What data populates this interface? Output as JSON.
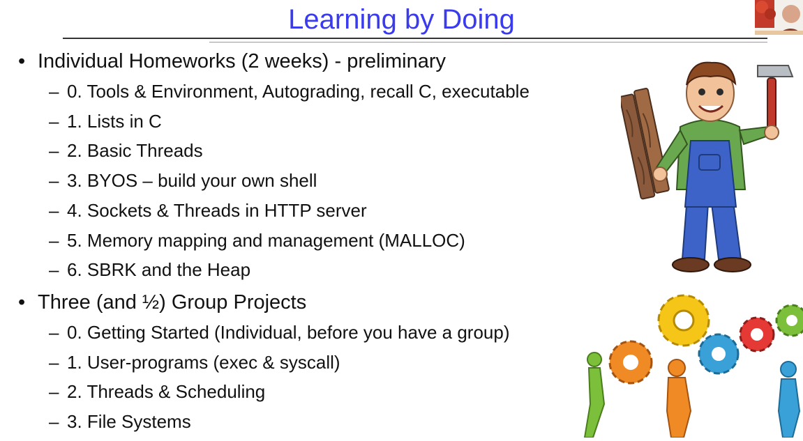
{
  "slide": {
    "title": "Learning by Doing",
    "sections": [
      {
        "heading": "Individual Homeworks (2 weeks) - preliminary",
        "items": [
          "0. Tools & Environment, Autograding, recall C, executable",
          "1. Lists in C",
          "2. Basic Threads",
          "3. BYOS – build your own shell",
          "4. Sockets & Threads in HTTP server",
          "5. Memory mapping and management (MALLOC)",
          "6. SBRK and the Heap"
        ]
      },
      {
        "heading": "Three (and ½) Group Projects",
        "items": [
          "0. Getting Started (Individual, before you have a group)",
          "1. User-programs (exec & syscall)",
          "2. Threads & Scheduling",
          "3. File Systems"
        ]
      }
    ],
    "bullet_glyph": "•",
    "dash_glyph": "–"
  },
  "illustrations": {
    "worker": "cartoon-carpenter-with-hammer-and-planks",
    "gears": "people-lifting-colorful-gears",
    "webcam": "presenter-webcam-thumbnail"
  },
  "colors": {
    "title": "#3a3aee",
    "text": "#111111",
    "rule": "#333333"
  }
}
